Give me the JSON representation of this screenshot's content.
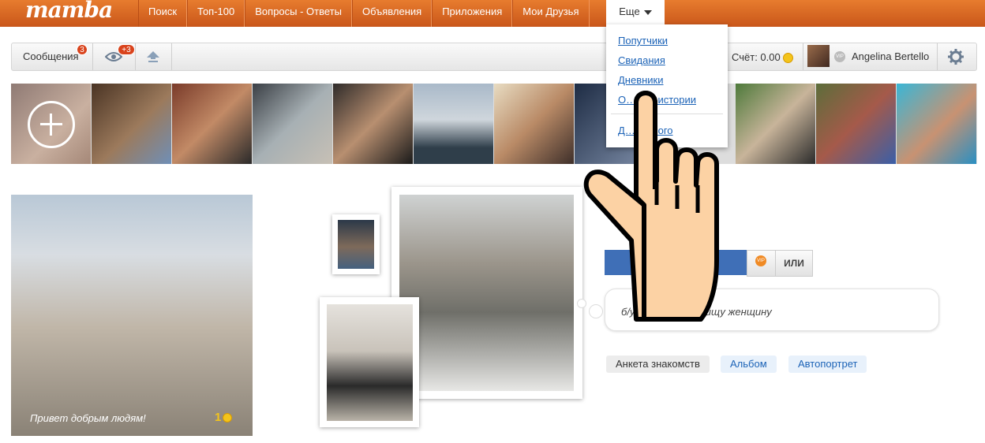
{
  "header": {
    "logo": "mamba",
    "nav": [
      "Поиск",
      "Топ-100",
      "Вопросы - Ответы",
      "Объявления",
      "Приложения",
      "Мои Друзья"
    ],
    "more_label": "Еще"
  },
  "dropdown": {
    "items": [
      "Попутчики",
      "Свидания",
      "Дневники",
      "О…ные истории",
      "Д…ильного"
    ]
  },
  "toolbar": {
    "messages_label": "Сообщения",
    "messages_badge": "3",
    "views_badge": "+3",
    "score_label": "Счёт: 0.00",
    "vip_mark": "VIP",
    "user_name": "Angelina Bertello"
  },
  "profile": {
    "greeting": "Привет добрым людям!",
    "coins": "1",
    "status_text": "б/у, … …тоянии, ищу женщину",
    "or_label": "ИЛИ",
    "vip_label": "VIP",
    "tabs": [
      "Анкета знакомств",
      "Альбом",
      "Автопортрет"
    ]
  },
  "colors": {
    "header_orange": "#d9621f",
    "link_blue": "#1c63b7",
    "badge_red": "#d9431c",
    "coin_gold": "#f3c41b"
  }
}
